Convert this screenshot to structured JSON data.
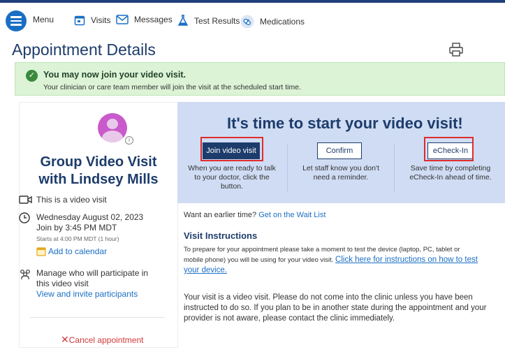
{
  "nav": {
    "menu_label": "Menu",
    "visits_label": "Visits",
    "messages_label": "Messages",
    "test_results_label": "Test Results",
    "medications_label": "Medications"
  },
  "page": {
    "title": "Appointment Details"
  },
  "banner": {
    "title": "You may now join your video visit.",
    "subtitle": "Your clinician or care team member will join the visit at the scheduled start time."
  },
  "visit": {
    "name_line1": "Group Video Visit",
    "name_line2": "with Lindsey Mills",
    "type": "This is a video visit",
    "date": "Wednesday August 02, 2023",
    "join_by": "Join by 3:45 PM MDT",
    "starts": "Starts at 4:00 PM MDT (1 hour)",
    "add_calendar": "Add to calendar",
    "participants_line1": "Manage who will participate in",
    "participants_line2": "this video visit",
    "invite_link": "View and invite participants",
    "cancel_label": "Cancel appointment"
  },
  "hero": {
    "title": "It's time to start your video visit!",
    "join_button": "Join video visit",
    "join_desc_1": "When you are ready to talk",
    "join_desc_2": "to your doctor, click the",
    "join_desc_3": "button.",
    "confirm_button": "Confirm",
    "confirm_desc_1": "Let staff know you don't",
    "confirm_desc_2": "need a reminder.",
    "echeckin_button": "eCheck-In",
    "echeckin_desc_1": "Save time by completing",
    "echeckin_desc_2": "eCheck-In ahead of time."
  },
  "content": {
    "earlier_prefix": "Want an earlier time?",
    "waitlist_link": "Get on the Wait List",
    "instructions_heading": "Visit Instructions",
    "instr_line1": "To prepare for your appointment please take a moment to test the device (laptop, PC, tablet or",
    "instr_line2_prefix": "mobile phone) you will be using for your video visit.",
    "instr_link_1": "Click here for instructions on how to test",
    "instr_link_2": "your device.",
    "para_line1": "Your visit is a video visit. Please do not come into the clinic unless you have been",
    "para_line2": "instructed to do so. If you plan to be in another state during the appointment and your",
    "para_line3": "provider is not aware, please contact the clinic immediately."
  },
  "colors": {
    "brand_navy": "#1d3c6b",
    "link_blue": "#1a6fc4",
    "banner_green": "#dcf3d6",
    "hero_blue": "#cfdcf3",
    "highlight_red": "#e02b2b",
    "cancel_red": "#d23a3a"
  },
  "icons": [
    "menu-icon",
    "visits-icon",
    "messages-icon",
    "test-results-icon",
    "medications-icon",
    "print-icon",
    "check-circle-icon",
    "avatar",
    "video-camera-icon",
    "clock-icon",
    "calendar-icon",
    "participants-icon",
    "cancel-x-icon"
  ]
}
